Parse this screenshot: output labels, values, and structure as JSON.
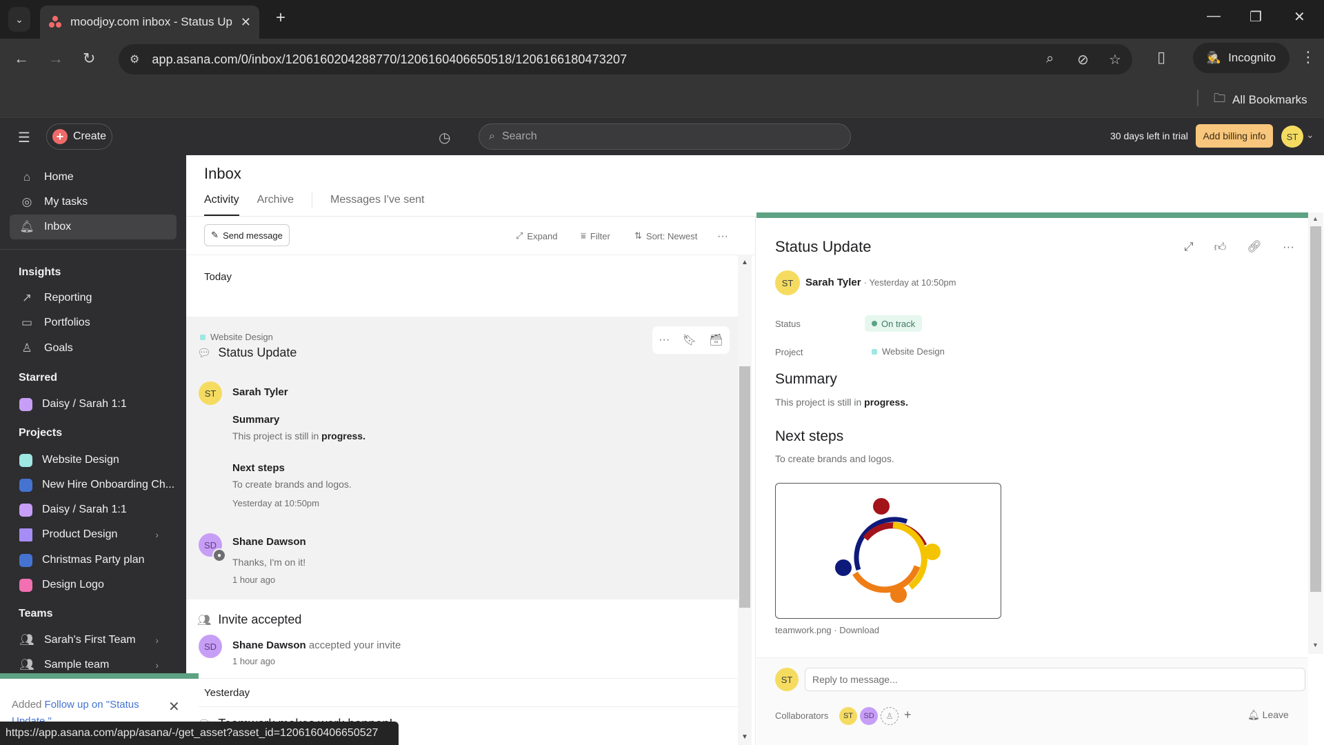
{
  "browser": {
    "tab_title": "moodjoy.com inbox - Status Up",
    "url": "app.asana.com/0/inbox/1206160204288770/1206160406650518/1206166180473207",
    "incognito_label": "Incognito",
    "all_bookmarks_label": "All Bookmarks",
    "status_url": "https://app.asana.com/app/asana/-/get_asset?asset_id=1206160406650527"
  },
  "topbar": {
    "create_label": "Create",
    "search_placeholder": "Search",
    "trial_text": "30 days left in trial",
    "billing_label": "Add billing info",
    "user_initials": "ST"
  },
  "sidebar": {
    "nav": [
      {
        "label": "Home",
        "icon": "home-icon"
      },
      {
        "label": "My tasks",
        "icon": "check-circle-icon"
      },
      {
        "label": "Inbox",
        "icon": "bell-icon",
        "active": true
      }
    ],
    "insights_heading": "Insights",
    "insights": [
      {
        "label": "Reporting",
        "icon": "chart-line-icon"
      },
      {
        "label": "Portfolios",
        "icon": "folder-icon"
      },
      {
        "label": "Goals",
        "icon": "goals-icon"
      }
    ],
    "starred_heading": "Starred",
    "starred": [
      {
        "label": "Daisy / Sarah 1:1",
        "color": "#c79ef5"
      }
    ],
    "projects_heading": "Projects",
    "projects": [
      {
        "label": "Website Design",
        "color": "#9ee7e3"
      },
      {
        "label": "New Hire Onboarding Ch...",
        "color": "#4573d2"
      },
      {
        "label": "Daisy / Sarah 1:1",
        "color": "#c79ef5"
      },
      {
        "label": "Product Design",
        "color": "#a68cf5"
      },
      {
        "label": "Christmas Party plan",
        "color": "#4573d2"
      },
      {
        "label": "Design Logo",
        "color": "#f26fb2"
      }
    ],
    "teams_heading": "Teams",
    "teams": [
      {
        "label": "Sarah's First Team"
      },
      {
        "label": "Sample team"
      }
    ]
  },
  "toast": {
    "prefix": "Added ",
    "link": "Follow up on \"Status Update \""
  },
  "inbox": {
    "title": "Inbox",
    "tabs": [
      "Activity",
      "Archive",
      "Messages I've sent"
    ],
    "toolbar": {
      "send_message": "Send message",
      "expand": "Expand",
      "filter": "Filter",
      "sort": "Sort: Newest"
    },
    "today_label": "Today",
    "yesterday_label": "Yesterday",
    "status_card": {
      "project": "Website Design",
      "title": "Status Update",
      "author": "Sarah Tyler",
      "author_initials": "ST",
      "summary_heading": "Summary",
      "summary_text": "This project is still in ",
      "summary_bold": "progress.",
      "next_heading": "Next steps",
      "next_text": "To create brands and logos.",
      "time": "Yesterday at 10:50pm",
      "reply_author": "Shane Dawson",
      "reply_initials": "SD",
      "reply_text": "Thanks, I'm on it!",
      "reply_time": "1 hour ago"
    },
    "invite_card": {
      "title": "Invite accepted",
      "actor": "Shane Dawson",
      "actor_initials": "SD",
      "action": " accepted your invite",
      "time": "1 hour ago"
    },
    "teamwork_item": {
      "title": "Teamwork makes work happen!"
    }
  },
  "detail": {
    "title": "Status Update",
    "author": "Sarah Tyler",
    "author_initials": "ST",
    "time": "· Yesterday at 10:50pm",
    "status_label": "Status",
    "status_value": "On track",
    "project_label": "Project",
    "project_value": "Website Design",
    "summary_heading": "Summary",
    "summary_text": "This project is still in ",
    "summary_bold": "progress.",
    "next_heading": "Next steps",
    "next_text": "To create brands and logos.",
    "attachment_name": "teamwork.png",
    "attachment_action": "Download",
    "reply_placeholder": "Reply to message...",
    "collaborators_label": "Collaborators",
    "collaborators": [
      "ST",
      "SD"
    ],
    "leave_label": "Leave",
    "accent_color": "#5da283"
  }
}
